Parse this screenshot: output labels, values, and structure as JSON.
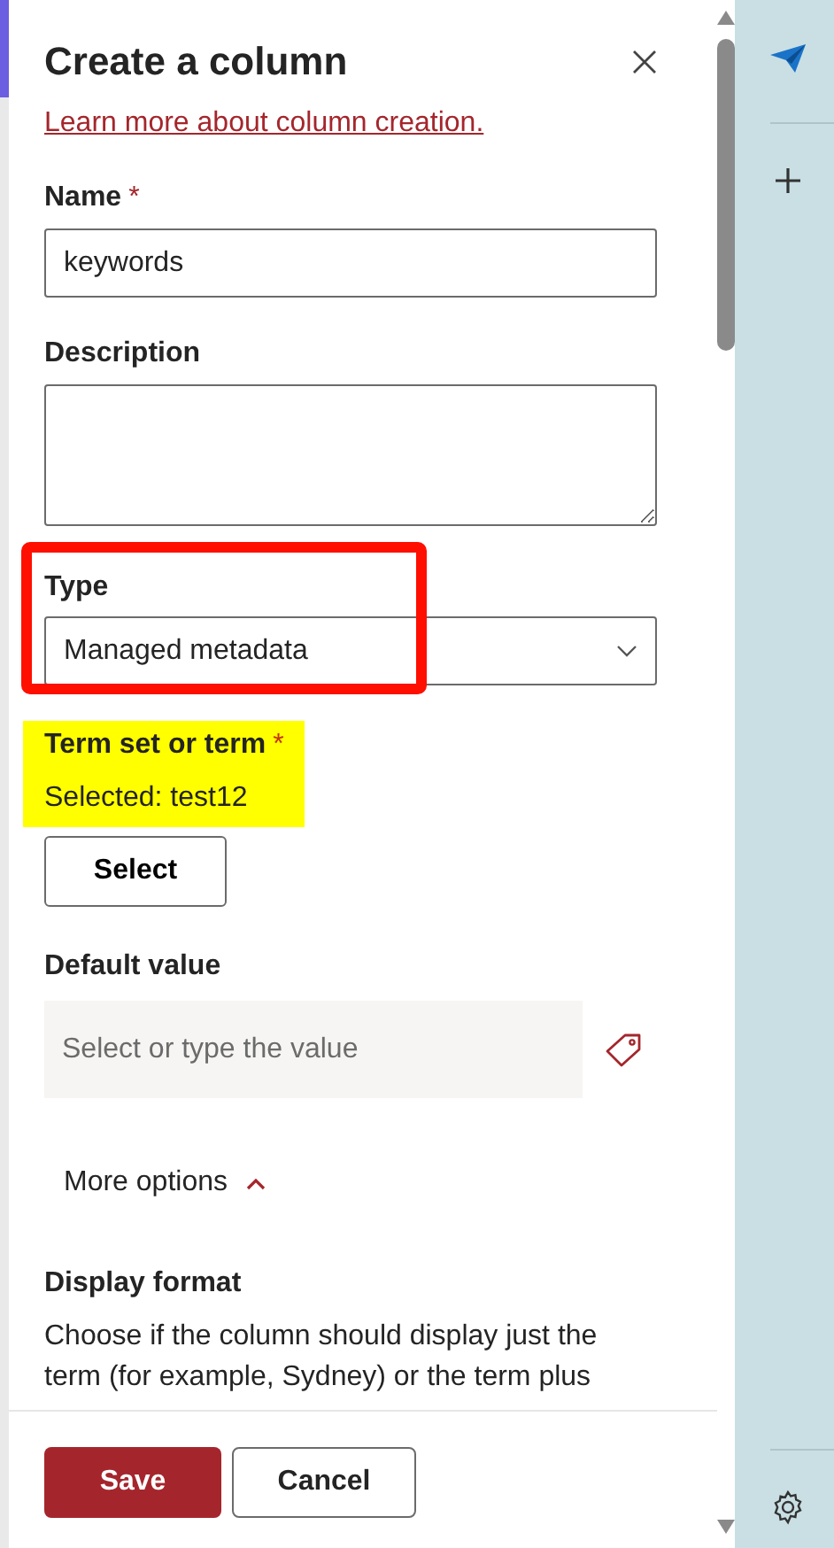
{
  "panel": {
    "title": "Create a column",
    "help_link": "Learn more about column creation.",
    "fields": [
      {
        "kind": "text",
        "label": "Name",
        "required_mark": "*",
        "value": "keywords"
      },
      {
        "kind": "textarea",
        "label": "Description"
      },
      {
        "kind": "select",
        "label": "Type",
        "value": "Managed metadata",
        "framed": true
      },
      {
        "kind": "term",
        "label": "Term set or term",
        "required_mark": "*",
        "selected_text": "Selected: test12",
        "button": "Select",
        "highlighted": true
      },
      {
        "kind": "tag-input",
        "label": "Default value",
        "placeholder": "Select or type the value"
      },
      {
        "kind": "toggle",
        "label": "More options",
        "expanded": true
      },
      {
        "kind": "paragraph",
        "label": "Display format",
        "text": "Choose if the column should display just the term (for example, Sydney) or the term plus"
      }
    ],
    "buttons": [
      {
        "label": "Save",
        "kind": "primary"
      },
      {
        "label": "Cancel",
        "kind": "secondary"
      }
    ]
  }
}
